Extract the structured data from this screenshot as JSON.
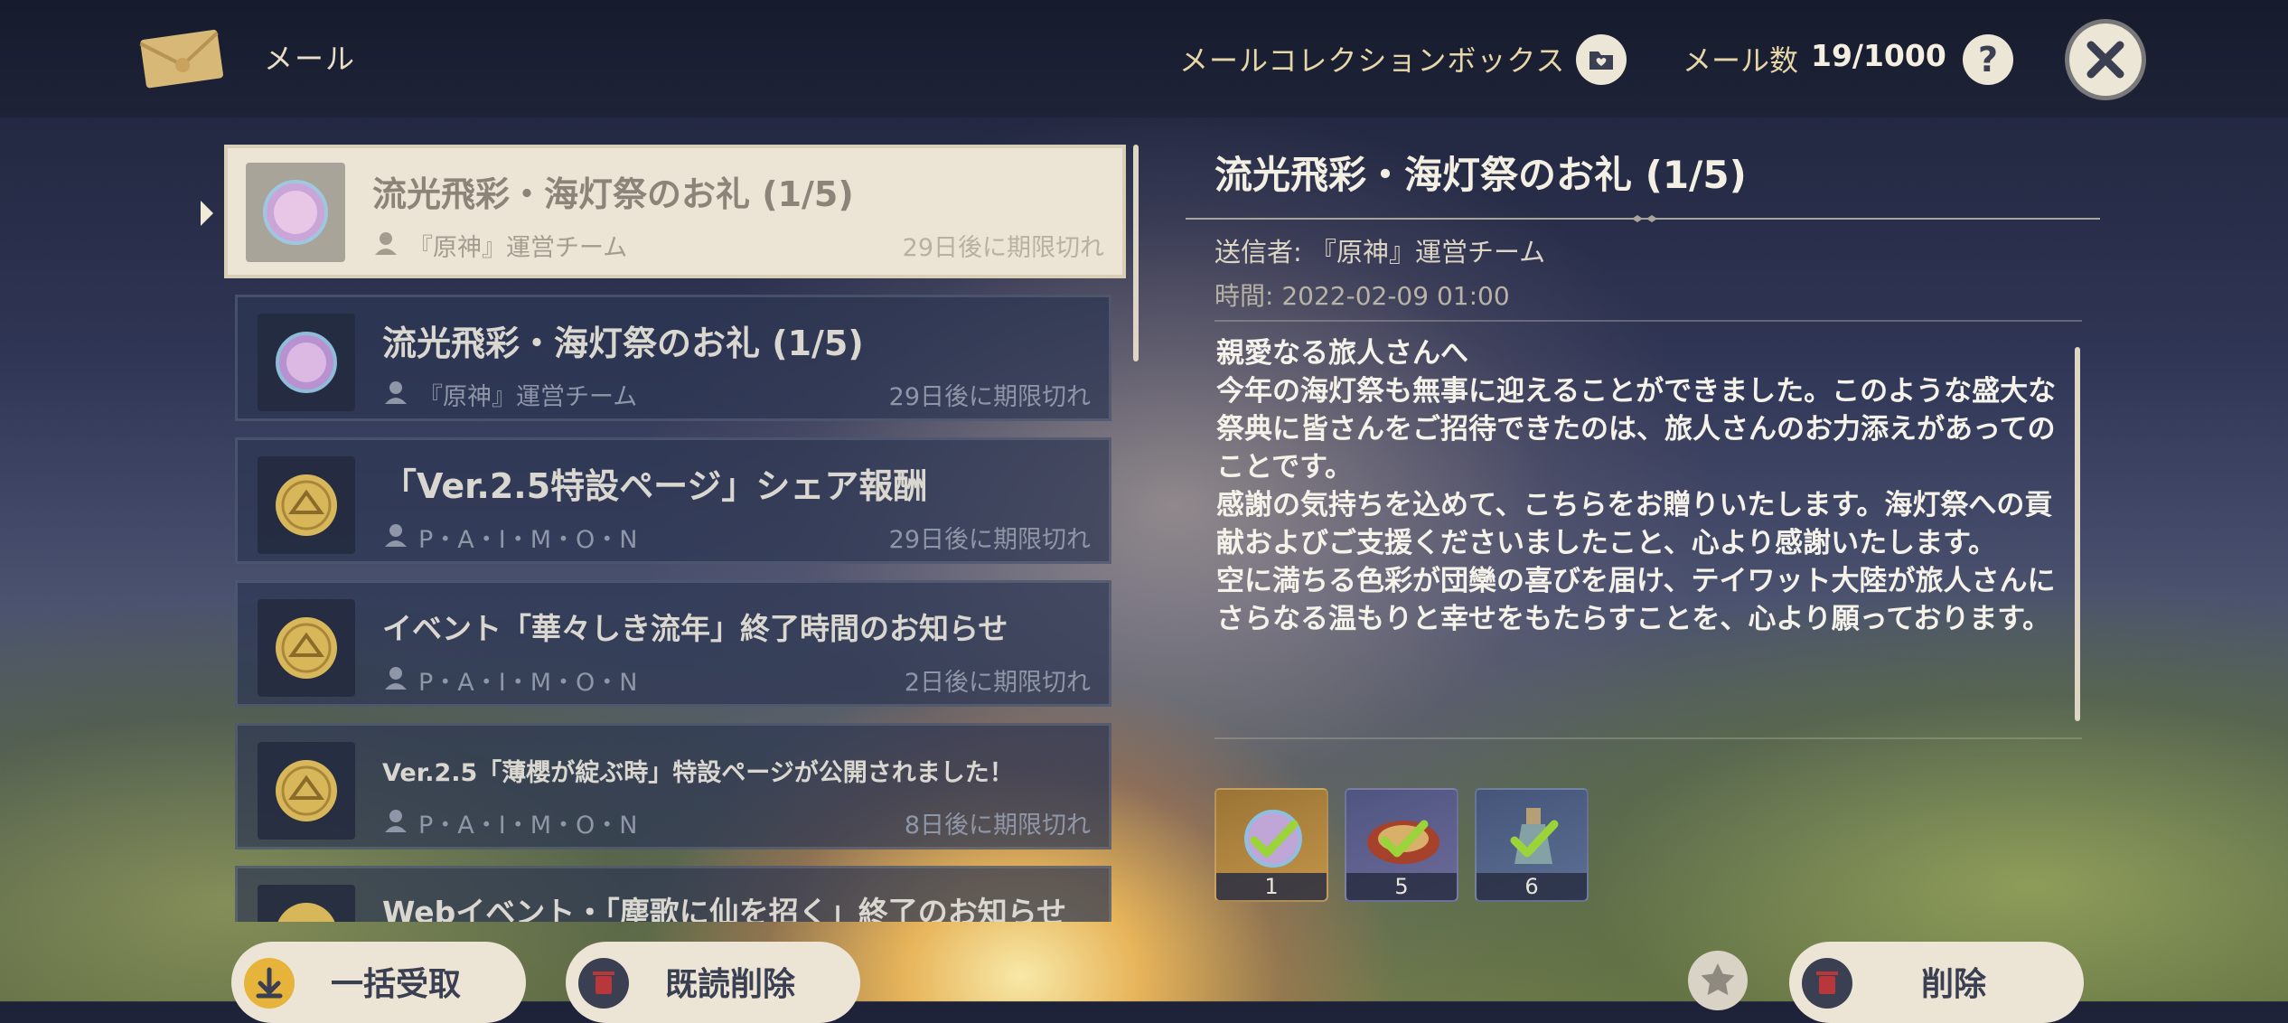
{
  "header": {
    "title": "メール",
    "collection_label": "メールコレクションボックス",
    "count_label": "メール数",
    "count_value": "19/1000",
    "help_label": "?"
  },
  "mail_list": [
    {
      "subject": "流光飛彩・海灯祭のお礼 (1/5)",
      "sender": "『原神』運営チーム",
      "expiry": "29日後に期限切れ",
      "icon": "starglitter-orb-icon",
      "selected": true
    },
    {
      "subject": "流光飛彩・海灯祭のお礼 (1/5)",
      "sender": "『原神』運営チーム",
      "expiry": "29日後に期限切れ",
      "icon": "starglitter-orb-icon",
      "selected": false
    },
    {
      "subject": "「Ver.2.5特設ページ」シェア報酬",
      "sender": "P・A・I・M・O・N",
      "expiry": "29日後に期限切れ",
      "icon": "paimon-coin-icon",
      "selected": false
    },
    {
      "subject": "イベント「華々しき流年」終了時間のお知らせ",
      "sender": "P・A・I・M・O・N",
      "expiry": "2日後に期限切れ",
      "icon": "paimon-coin-icon",
      "selected": false
    },
    {
      "subject": "Ver.2.5「薄櫻が綻ぶ時」特設ページが公開されました！",
      "sender": "P・A・I・M・O・N",
      "expiry": "8日後に期限切れ",
      "icon": "paimon-coin-icon",
      "selected": false
    },
    {
      "subject": "Webイベント・「塵歌に仙を招く」終了のお知らせ",
      "sender": "",
      "expiry": "",
      "icon": "paimon-coin-icon",
      "selected": false
    }
  ],
  "detail": {
    "subject": "流光飛彩・海灯祭のお礼 (1/5)",
    "sender": "送信者: 『原神』運営チーム",
    "time": "時間: 2022-02-09 01:00",
    "body": "親愛なる旅人さんへ\n今年の海灯祭も無事に迎えることができました。このような盛大な祭典に皆さんをご招待できたのは、旅人さんのお力添えがあってのことです。\n感謝の気持ちを込めて、こちらをお贈りいたします。海灯祭への貢献およびご支援くださいましたこと、心より感謝いたします。\n空に満ちる色彩が団欒の喜びを届け、テイワット大陸が旅人さんにさらなる温もりと幸せをもたらすことを、心より願っております。",
    "rewards": [
      {
        "icon": "primogem-icon",
        "qty": "1",
        "claimed": true
      },
      {
        "icon": "dish-icon",
        "qty": "5",
        "claimed": true
      },
      {
        "icon": "potion-icon",
        "qty": "6",
        "claimed": true
      }
    ]
  },
  "buttons": {
    "claim_all": "一括受取",
    "delete_read": "既読削除",
    "delete": "削除"
  },
  "colors": {
    "panel_light": "#ece5d6",
    "text_dark": "#3a3f52",
    "gold": "#d8b75a",
    "check_green": "#9ad43a",
    "danger_red": "#b7373a"
  }
}
